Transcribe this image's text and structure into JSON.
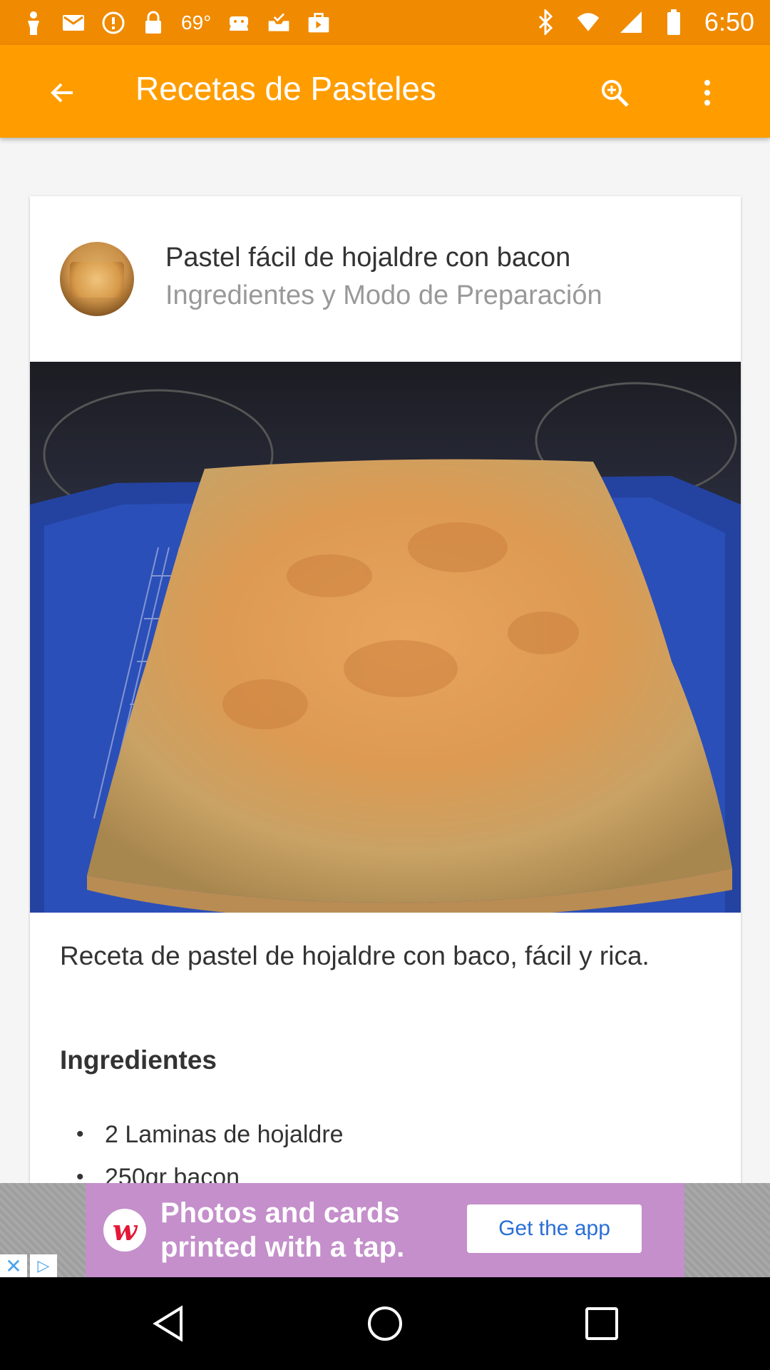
{
  "status_bar": {
    "temperature": "69°",
    "time": "6:50",
    "left_icons": [
      "person-icon",
      "mail-icon",
      "info-icon",
      "lock-icon",
      "android-icon",
      "inbox-check-icon",
      "bag-icon"
    ],
    "right_icons": [
      "bluetooth-icon",
      "wifi-icon",
      "signal-icon",
      "battery-icon"
    ]
  },
  "app_bar": {
    "title": "Recetas de Pasteles",
    "color": "#ff9d00"
  },
  "recipe": {
    "title": "Pastel fácil de hojaldre con bacon",
    "subtitle": "Ingredientes y Modo de Preparación",
    "description": "Receta de pastel de hojaldre con baco, fácil y rica.",
    "ingredients_heading": "Ingredientes",
    "ingredients": [
      "2 Laminas de hojaldre",
      "250gr bacon"
    ]
  },
  "ad": {
    "line1": "Photos and cards",
    "line2": "printed with a tap.",
    "cta": "Get the app",
    "logo": "w"
  },
  "nav": {
    "icons": [
      "back-icon",
      "home-icon",
      "recents-icon"
    ]
  }
}
